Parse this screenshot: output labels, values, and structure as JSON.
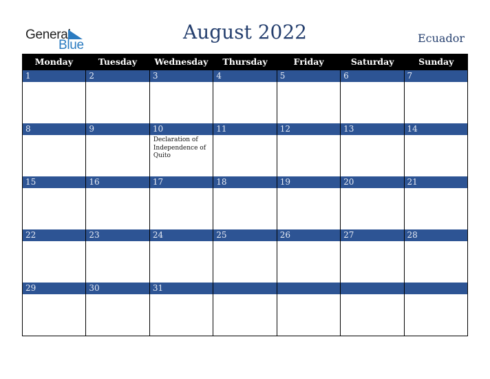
{
  "logo": {
    "line1": "General",
    "line2": "Blue"
  },
  "title": "August 2022",
  "country": "Ecuador",
  "colors": {
    "header_bg": "#000000",
    "day_bar": "#2d5494",
    "title": "#253f6e",
    "logo_blue": "#2b7bc0"
  },
  "weekdays": [
    "Monday",
    "Tuesday",
    "Wednesday",
    "Thursday",
    "Friday",
    "Saturday",
    "Sunday"
  ],
  "weeks": [
    [
      {
        "day": "1",
        "event": ""
      },
      {
        "day": "2",
        "event": ""
      },
      {
        "day": "3",
        "event": ""
      },
      {
        "day": "4",
        "event": ""
      },
      {
        "day": "5",
        "event": ""
      },
      {
        "day": "6",
        "event": ""
      },
      {
        "day": "7",
        "event": ""
      }
    ],
    [
      {
        "day": "8",
        "event": ""
      },
      {
        "day": "9",
        "event": ""
      },
      {
        "day": "10",
        "event": "Declaration of Independence of Quito"
      },
      {
        "day": "11",
        "event": ""
      },
      {
        "day": "12",
        "event": ""
      },
      {
        "day": "13",
        "event": ""
      },
      {
        "day": "14",
        "event": ""
      }
    ],
    [
      {
        "day": "15",
        "event": ""
      },
      {
        "day": "16",
        "event": ""
      },
      {
        "day": "17",
        "event": ""
      },
      {
        "day": "18",
        "event": ""
      },
      {
        "day": "19",
        "event": ""
      },
      {
        "day": "20",
        "event": ""
      },
      {
        "day": "21",
        "event": ""
      }
    ],
    [
      {
        "day": "22",
        "event": ""
      },
      {
        "day": "23",
        "event": ""
      },
      {
        "day": "24",
        "event": ""
      },
      {
        "day": "25",
        "event": ""
      },
      {
        "day": "26",
        "event": ""
      },
      {
        "day": "27",
        "event": ""
      },
      {
        "day": "28",
        "event": ""
      }
    ],
    [
      {
        "day": "29",
        "event": ""
      },
      {
        "day": "30",
        "event": ""
      },
      {
        "day": "31",
        "event": ""
      },
      {
        "day": "",
        "event": ""
      },
      {
        "day": "",
        "event": ""
      },
      {
        "day": "",
        "event": ""
      },
      {
        "day": "",
        "event": ""
      }
    ]
  ]
}
